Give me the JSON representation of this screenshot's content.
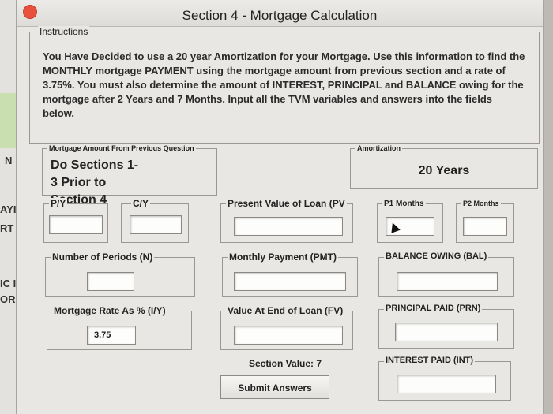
{
  "window": {
    "title": "Section 4 - Mortgage Calculation"
  },
  "background_fragments": {
    "a": "N",
    "b": "AYI",
    "c": "RT",
    "d": "IC I",
    "e": "OR"
  },
  "instructions": {
    "label": "Instructions",
    "text": "You Have Decided to use a 20 year Amortization for your Mortgage. Use this information to find the MONTHLY mortgage PAYMENT using the mortgage amount from previous section and a rate of 3.75%. You must also determine the amount of INTEREST, PRINCIPAL and BALANCE owing for the mortgage after 2 Years and 7 Months. Input all the TVM variables and answers into the fields below."
  },
  "mortgage_amount": {
    "label": "Mortgage Amount From Previous Question",
    "value": "Do Sections 1-3 Prior to Section 4"
  },
  "amortization": {
    "label": "Amortization",
    "value": "20 Years"
  },
  "fields": {
    "py": {
      "label": "P/Y",
      "value": ""
    },
    "cy": {
      "label": "C/Y",
      "value": ""
    },
    "pv": {
      "label": "Present Value of Loan (PV",
      "value": ""
    },
    "p1": {
      "label": "P1 Months",
      "value": ""
    },
    "p2": {
      "label": "P2 Months",
      "value": ""
    },
    "n": {
      "label": "Number of Periods (N)",
      "value": ""
    },
    "pmt": {
      "label": "Monthly Payment (PMT)",
      "value": ""
    },
    "bal": {
      "label": "BALANCE OWING (BAL)",
      "value": ""
    },
    "iy": {
      "label": "Mortgage Rate As % (I/Y)",
      "value": "3.75"
    },
    "fv": {
      "label": "Value At End of Loan (FV)",
      "value": ""
    },
    "prn": {
      "label": "PRINCIPAL PAID (PRN)",
      "value": ""
    },
    "int": {
      "label": "INTEREST PAID (INT)",
      "value": ""
    }
  },
  "section_value": "Section Value: 7",
  "submit_label": "Submit Answers",
  "colors": {
    "close_button": "#e9513f",
    "window_bg": "#e9e7e3"
  }
}
